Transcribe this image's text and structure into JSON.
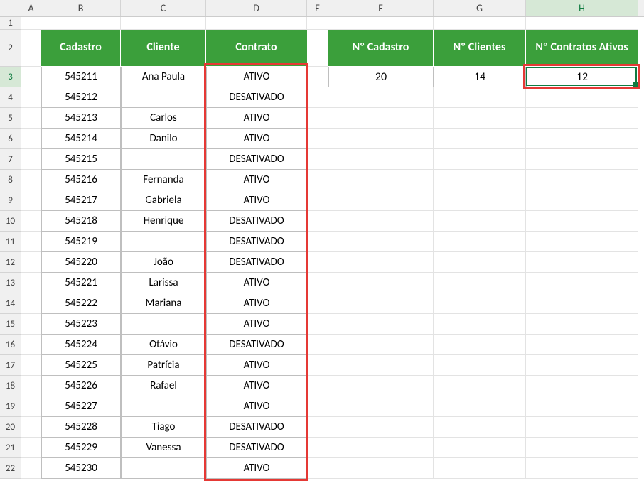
{
  "columns": [
    "A",
    "B",
    "C",
    "D",
    "E",
    "F",
    "G",
    "H"
  ],
  "col_widths": [
    "wA",
    "wB",
    "wC",
    "wD",
    "wE",
    "wF",
    "wG",
    "wH"
  ],
  "selected_col": "H",
  "rows": [
    1,
    2,
    3,
    4,
    5,
    6,
    7,
    8,
    9,
    10,
    11,
    12,
    13,
    14,
    15,
    16,
    17,
    18,
    19,
    20,
    21,
    22
  ],
  "selected_row": 3,
  "table1": {
    "headers": {
      "cadastro": "Cadastro",
      "cliente": "Cliente",
      "contrato": "Contrato"
    },
    "rows": [
      {
        "cadastro": "545211",
        "cliente": "Ana Paula",
        "contrato": "ATIVO"
      },
      {
        "cadastro": "545212",
        "cliente": "",
        "contrato": "DESATIVADO"
      },
      {
        "cadastro": "545213",
        "cliente": "Carlos",
        "contrato": "ATIVO"
      },
      {
        "cadastro": "545214",
        "cliente": "Danilo",
        "contrato": "ATIVO"
      },
      {
        "cadastro": "545215",
        "cliente": "",
        "contrato": "DESATIVADO"
      },
      {
        "cadastro": "545216",
        "cliente": "Fernanda",
        "contrato": "ATIVO"
      },
      {
        "cadastro": "545217",
        "cliente": "Gabriela",
        "contrato": "ATIVO"
      },
      {
        "cadastro": "545218",
        "cliente": "Henrique",
        "contrato": "DESATIVADO"
      },
      {
        "cadastro": "545219",
        "cliente": "",
        "contrato": "DESATIVADO"
      },
      {
        "cadastro": "545220",
        "cliente": "João",
        "contrato": "DESATIVADO"
      },
      {
        "cadastro": "545221",
        "cliente": "Larissa",
        "contrato": "ATIVO"
      },
      {
        "cadastro": "545222",
        "cliente": "Mariana",
        "contrato": "ATIVO"
      },
      {
        "cadastro": "545223",
        "cliente": "",
        "contrato": "ATIVO"
      },
      {
        "cadastro": "545224",
        "cliente": "Otávio",
        "contrato": "DESATIVADO"
      },
      {
        "cadastro": "545225",
        "cliente": "Patrícia",
        "contrato": "ATIVO"
      },
      {
        "cadastro": "545226",
        "cliente": "Rafael",
        "contrato": "ATIVO"
      },
      {
        "cadastro": "545227",
        "cliente": "",
        "contrato": "ATIVO"
      },
      {
        "cadastro": "545228",
        "cliente": "Tiago",
        "contrato": "DESATIVADO"
      },
      {
        "cadastro": "545229",
        "cliente": "Vanessa",
        "contrato": "DESATIVADO"
      },
      {
        "cadastro": "545230",
        "cliente": "",
        "contrato": "ATIVO"
      }
    ]
  },
  "table2": {
    "headers": {
      "ncadastro": "Nº Cadastro",
      "nclientes": "Nº Clientes",
      "ncontratos": "Nº Contratos Ativos"
    },
    "values": {
      "ncadastro": "20",
      "nclientes": "14",
      "ncontratos": "12"
    }
  },
  "active_cell_value": "12"
}
